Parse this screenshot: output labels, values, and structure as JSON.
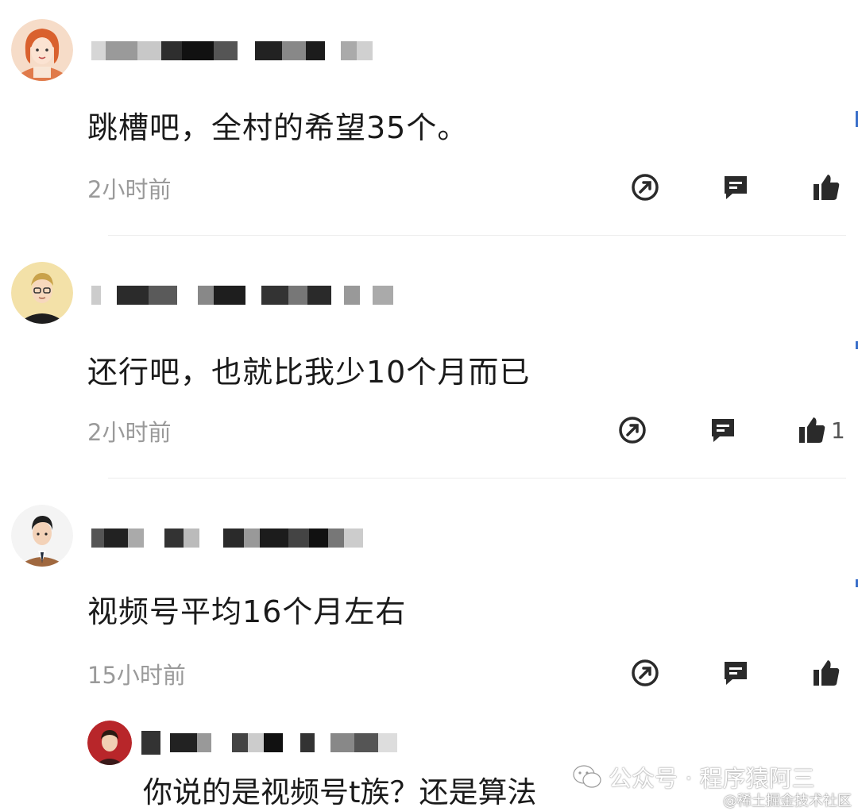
{
  "comments": [
    {
      "text": "跳槽吧，全村的希望35个。",
      "time": "2小时前",
      "likes": ""
    },
    {
      "text": "还行吧，也就比我少10个月而已",
      "time": "2小时前",
      "likes": "1"
    },
    {
      "text": "视频号平均16个月左右",
      "time": "15小时前",
      "likes": ""
    }
  ],
  "reply": {
    "text": "你说的是视频号t族？还是算法"
  },
  "watermark": {
    "primary": "公众号 · 程序猿阿三",
    "secondary": "@稀土掘金技术社区"
  },
  "icons": {
    "share": "share-icon",
    "reply": "comment-icon",
    "like": "thumbs-up-icon",
    "wechat": "wechat-icon"
  }
}
